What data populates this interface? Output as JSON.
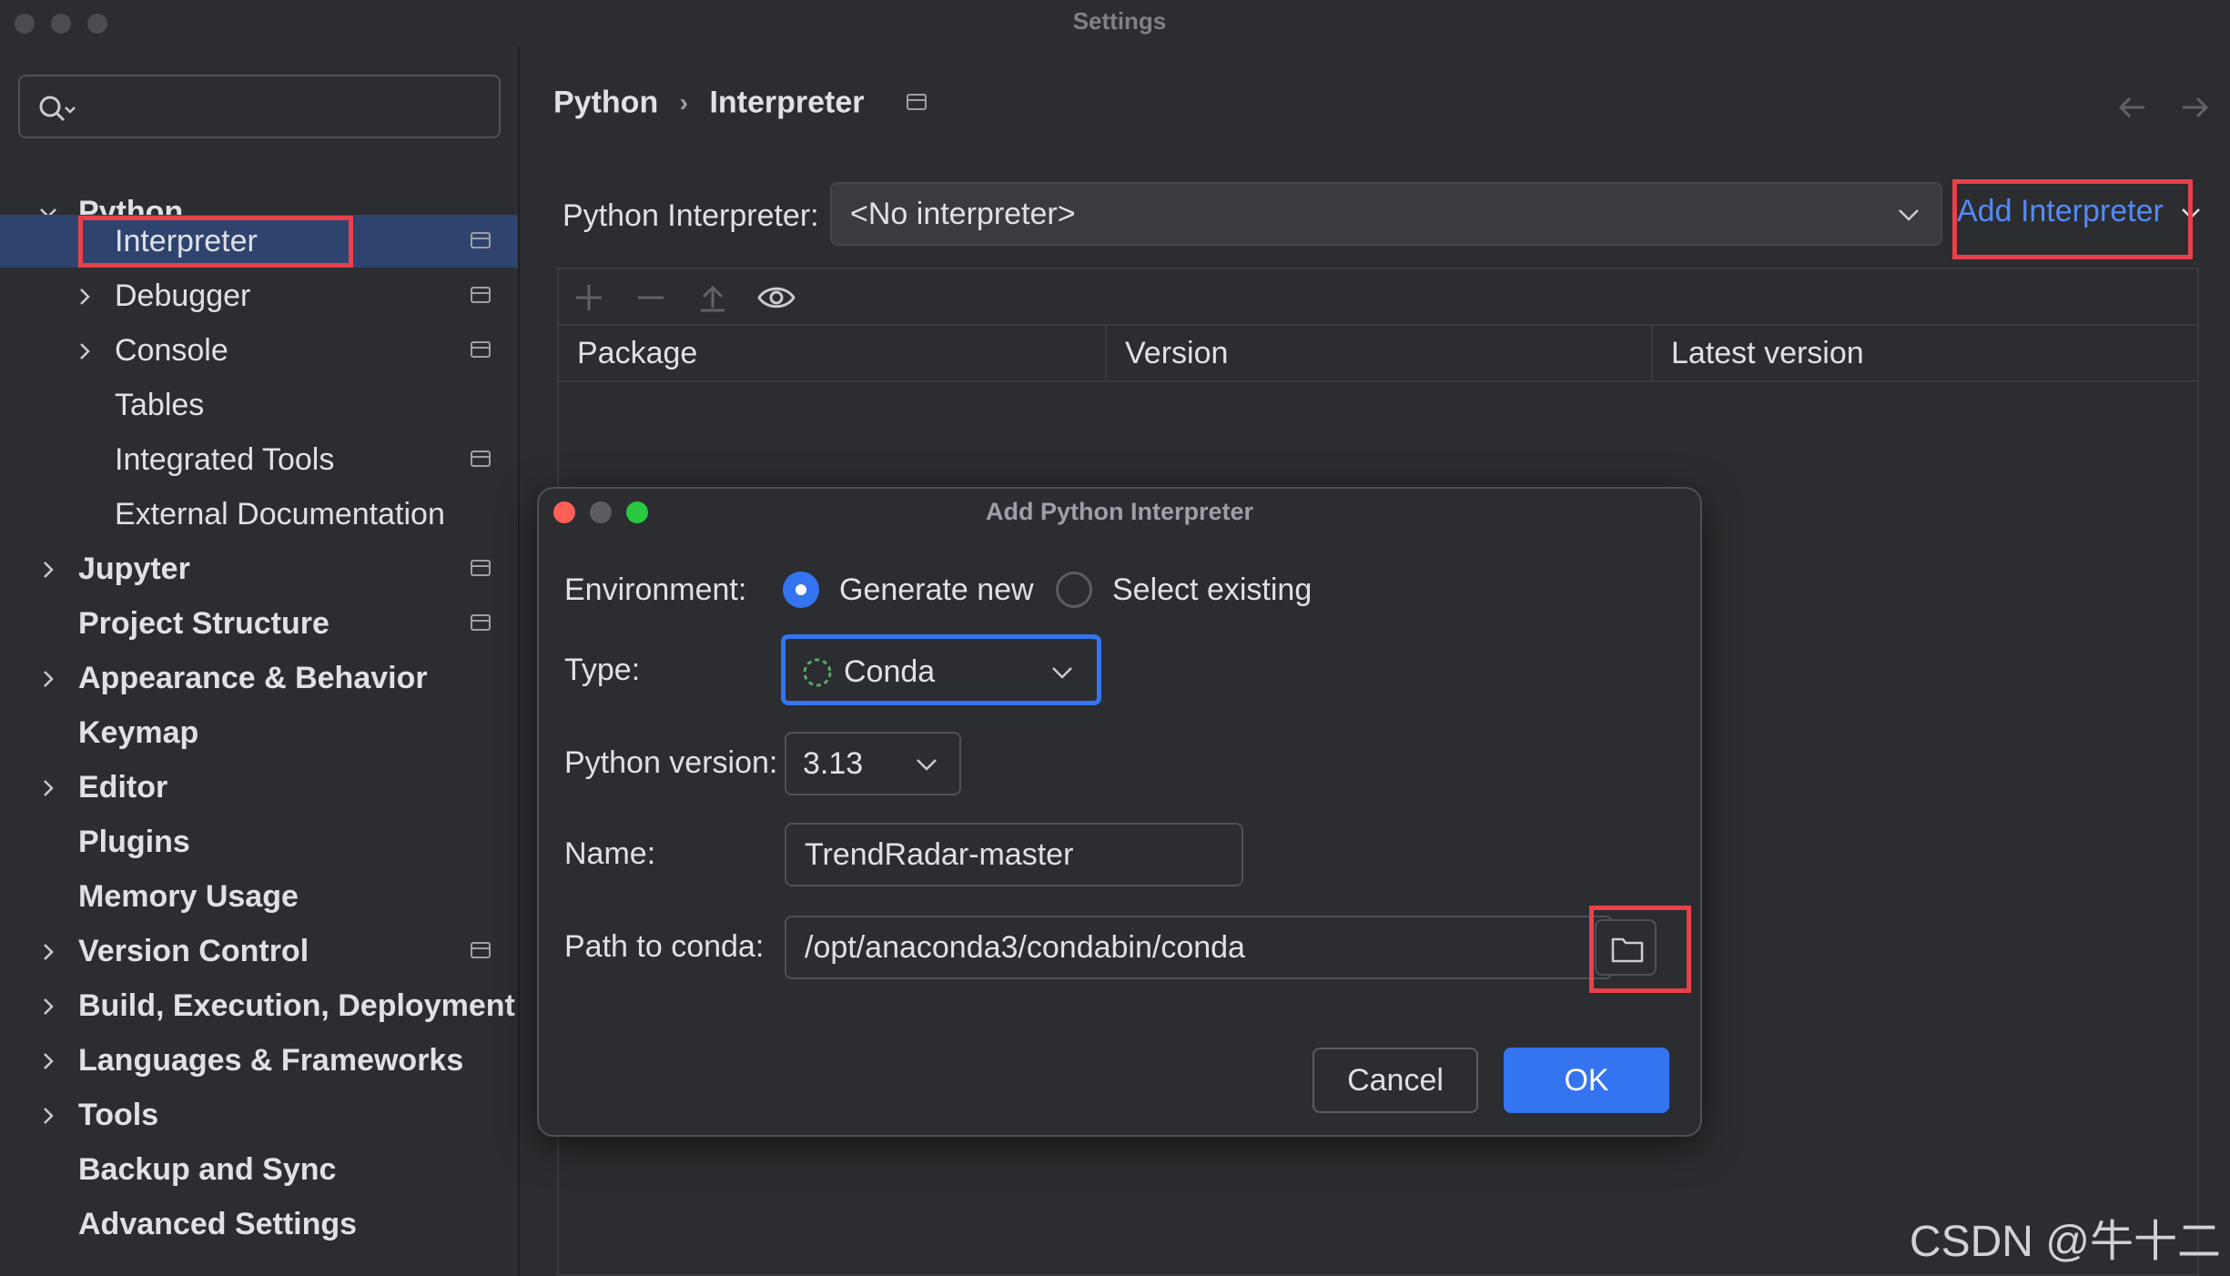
{
  "window": {
    "title": "Settings"
  },
  "search": {
    "placeholder": ""
  },
  "sidebar": {
    "items": [
      {
        "label": "Python"
      },
      {
        "label": "Interpreter"
      },
      {
        "label": "Debugger"
      },
      {
        "label": "Console"
      },
      {
        "label": "Tables"
      },
      {
        "label": "Integrated Tools"
      },
      {
        "label": "External Documentation"
      },
      {
        "label": "Jupyter"
      },
      {
        "label": "Project Structure"
      },
      {
        "label": "Appearance & Behavior"
      },
      {
        "label": "Keymap"
      },
      {
        "label": "Editor"
      },
      {
        "label": "Plugins"
      },
      {
        "label": "Memory Usage"
      },
      {
        "label": "Version Control"
      },
      {
        "label": "Build, Execution, Deployment"
      },
      {
        "label": "Languages & Frameworks"
      },
      {
        "label": "Tools"
      },
      {
        "label": "Backup and Sync"
      },
      {
        "label": "Advanced Settings"
      }
    ]
  },
  "breadcrumb": {
    "parent": "Python",
    "sep": "›",
    "current": "Interpreter"
  },
  "interpreter": {
    "label": "Python Interpreter:",
    "value": "<No interpreter>",
    "add_button": "Add Interpreter"
  },
  "packages": {
    "columns": [
      "Package",
      "Version",
      "Latest version"
    ]
  },
  "dialog": {
    "title": "Add Python Interpreter",
    "environment_label": "Environment:",
    "option_generate": "Generate new",
    "option_select": "Select existing",
    "type_label": "Type:",
    "type_value": "Conda",
    "python_version_label": "Python version:",
    "python_version_value": "3.13",
    "name_label": "Name:",
    "name_value": "TrendRadar-master",
    "path_label": "Path to conda:",
    "path_value": "/opt/anaconda3/condabin/conda",
    "cancel": "Cancel",
    "ok": "OK"
  },
  "colors": {
    "accent": "#3574f0",
    "link": "#548af7",
    "highlight_box": "#e8414b",
    "selection": "#2e436e"
  },
  "watermark": "CSDN @牛十二"
}
